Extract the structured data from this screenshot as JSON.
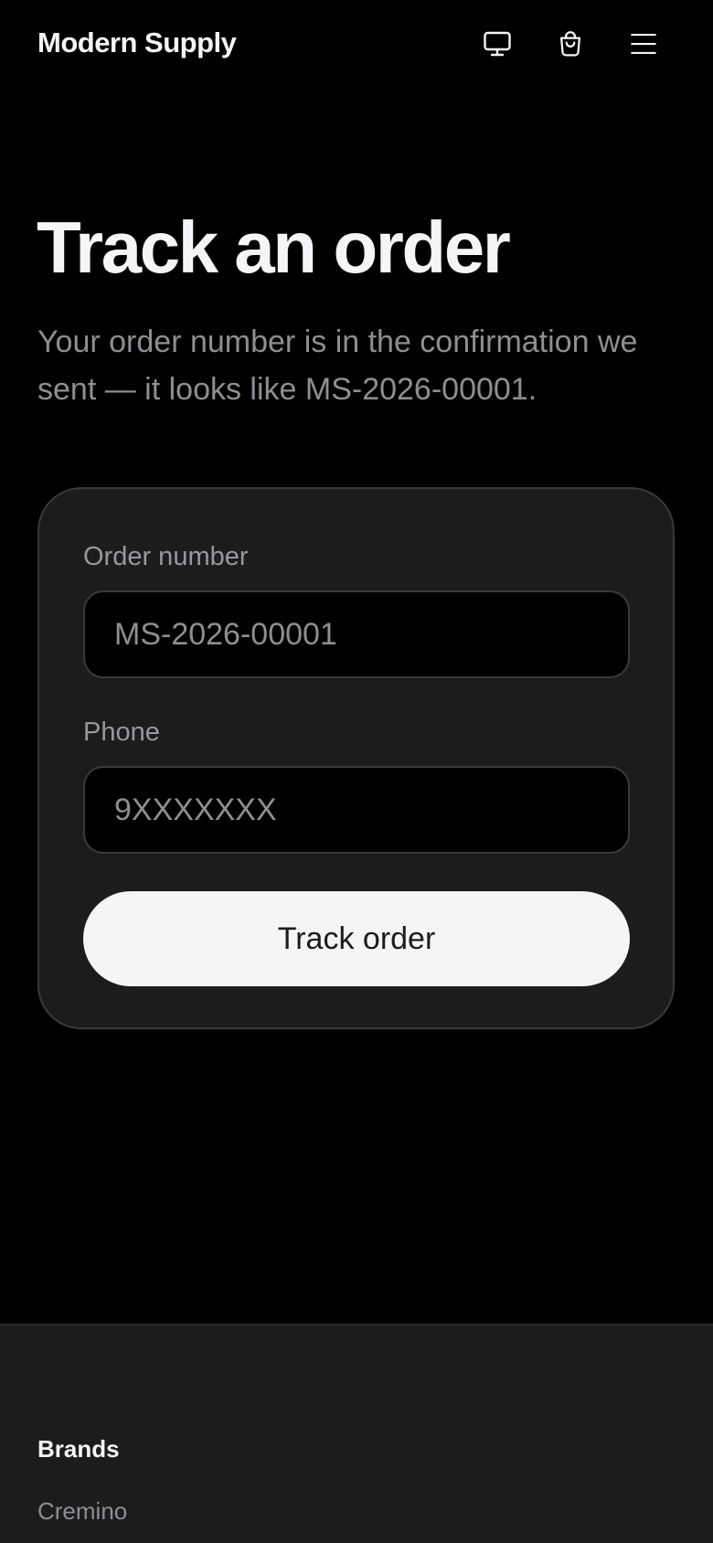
{
  "header": {
    "brand": "Modern Supply",
    "icons": [
      "monitor-icon",
      "shopping-bag-icon",
      "menu-icon"
    ]
  },
  "main": {
    "title": "Track an order",
    "description": "Your order number is in the confirmation we sent — it looks like MS-2026-00001."
  },
  "form": {
    "order_label": "Order number",
    "order_placeholder": "MS-2026-00001",
    "phone_label": "Phone",
    "phone_placeholder": "9XXXXXXX",
    "submit_label": "Track order"
  },
  "footer": {
    "heading": "Brands",
    "links": [
      "Cremino"
    ]
  },
  "colors": {
    "background": "#000000",
    "card": "#1c1c1e",
    "text": "#f5f5f7",
    "muted": "#8e8e93",
    "border": "#3a3a3c",
    "button": "#f5f5f7"
  }
}
